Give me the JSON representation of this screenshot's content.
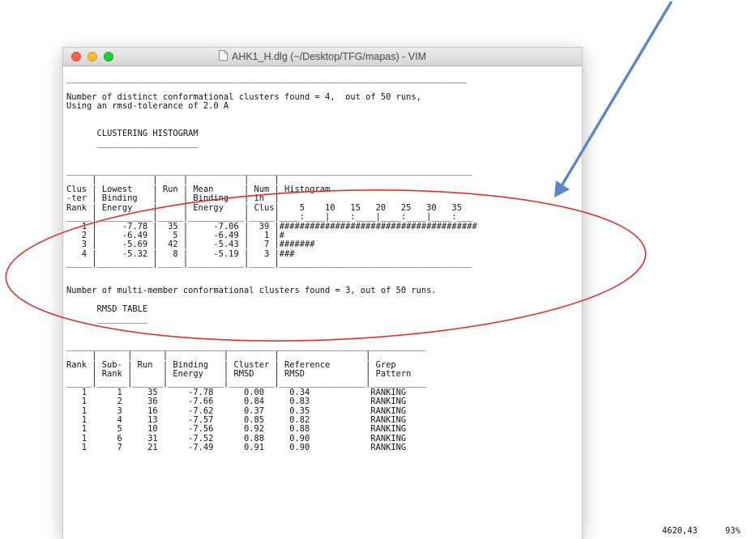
{
  "window": {
    "title": "AHK1_H.dlg (~/Desktop/TFG/mapas) - VIM"
  },
  "editor": {
    "lines": [
      "_______________________________________________________________________________",
      "",
      "Number of distinct conformational clusters found = 4,  out of 50 runs,",
      "Using an rmsd-tolerance of 2.0 A",
      "",
      "",
      "      CLUSTERING HISTOGRAM",
      "      ____________________",
      "",
      "",
      "________________________________________________________________________________",
      "     |           |     |           |     |",
      "Clus | Lowest    | Run | Mean      | Num | Histogram",
      "-ter | Binding   |     | Binding   | in  |",
      "Rank | Energy    |     | Energy    | Clus|    5    10   15   20   25   30   35",
      "_____|___________|_____|___________|_____|____:____|____:____|____:____|____:___",
      "   1 |     -7.78 |  35 |     -7.06 |  39 |#######################################",
      "   2 |     -6.49 |   5 |     -6.49 |   1 |#",
      "   3 |     -5.69 |  42 |     -5.43 |   7 |#######",
      "   4 |     -5.32 |   8 |     -5.19 |   3 |###",
      "_____|___________|_____|___________|_____|______________________________________",
      "",
      "",
      "Number of multi-member conformational clusters found = 3, out of 50 runs.",
      "",
      "      RMSD TABLE",
      "      __________",
      "",
      "",
      "_______________________________________________________________________",
      "     |      |      |           |         |                 |",
      "Rank | Sub- | Run  | Binding   | Cluster | Reference       | Grep",
      "     | Rank |      | Energy    | RMSD    | RMSD            | Pattern",
      "_____|______|______|___________|_________|_________________|___________",
      "   1      1     35      -7.78      0.00     0.34            RANKING",
      "   1      2     36      -7.66      0.84     0.83            RANKING",
      "   1      3     16      -7.62      0.37     0.35            RANKING",
      "   1      4     13      -7.57      0.85     0.82            RANKING",
      "   1      5     10      -7.56      0.92     0.88            RANKING",
      "   1      6     31      -7.52      0.88     0.90            RANKING",
      "   1      7     21      -7.49      0.91     0.90            RANKING"
    ]
  },
  "statusline": {
    "position": "4620,43",
    "percent": "93%"
  },
  "annotations": {
    "arrow_color": "#5a88c6",
    "ellipse_color": "#d8352a"
  }
}
